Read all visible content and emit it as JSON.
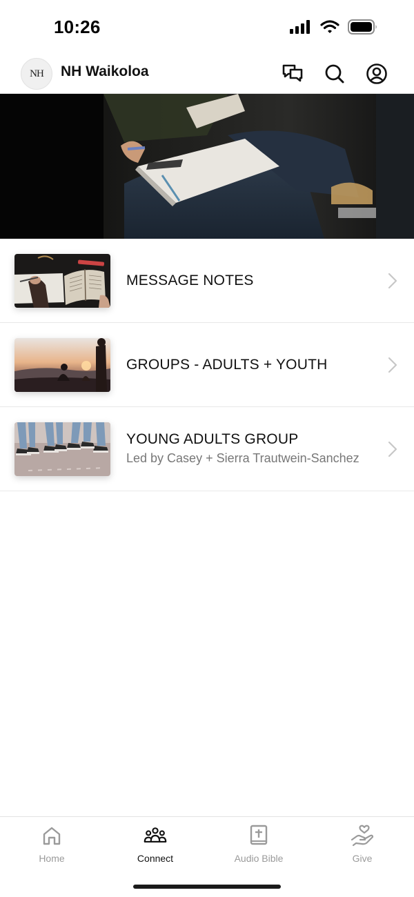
{
  "status_bar": {
    "time": "10:26",
    "icons": [
      "cellular-signal-icon",
      "wifi-icon",
      "battery-icon"
    ]
  },
  "header": {
    "logo_text": "NH",
    "title": "NH Waikoloa",
    "actions": [
      {
        "name": "chat-icon"
      },
      {
        "name": "search-icon"
      },
      {
        "name": "profile-icon"
      }
    ]
  },
  "hero": {
    "image": "people-taking-notes-photo"
  },
  "list": {
    "items": [
      {
        "title": "MESSAGE NOTES",
        "subtitle": "",
        "thumbnail": "bible-and-notebook-photo"
      },
      {
        "title": "GROUPS - ADULTS + YOUTH",
        "subtitle": "",
        "thumbnail": "sunset-hillside-photo"
      },
      {
        "title": "YOUNG ADULTS GROUP",
        "subtitle": "Led by Casey + Sierra Trautwein-Sanchez",
        "thumbnail": "sneakers-photo"
      }
    ]
  },
  "tabs": [
    {
      "label": "Home",
      "icon": "home-icon",
      "active": false
    },
    {
      "label": "Connect",
      "icon": "people-icon",
      "active": true
    },
    {
      "label": "Audio Bible",
      "icon": "bible-icon",
      "active": false
    },
    {
      "label": "Give",
      "icon": "give-heart-hand-icon",
      "active": false
    }
  ],
  "colors": {
    "active_tab": "#111111",
    "inactive_tab": "#9a9a9a",
    "divider": "#e8e8e8",
    "subtitle": "#777777"
  }
}
